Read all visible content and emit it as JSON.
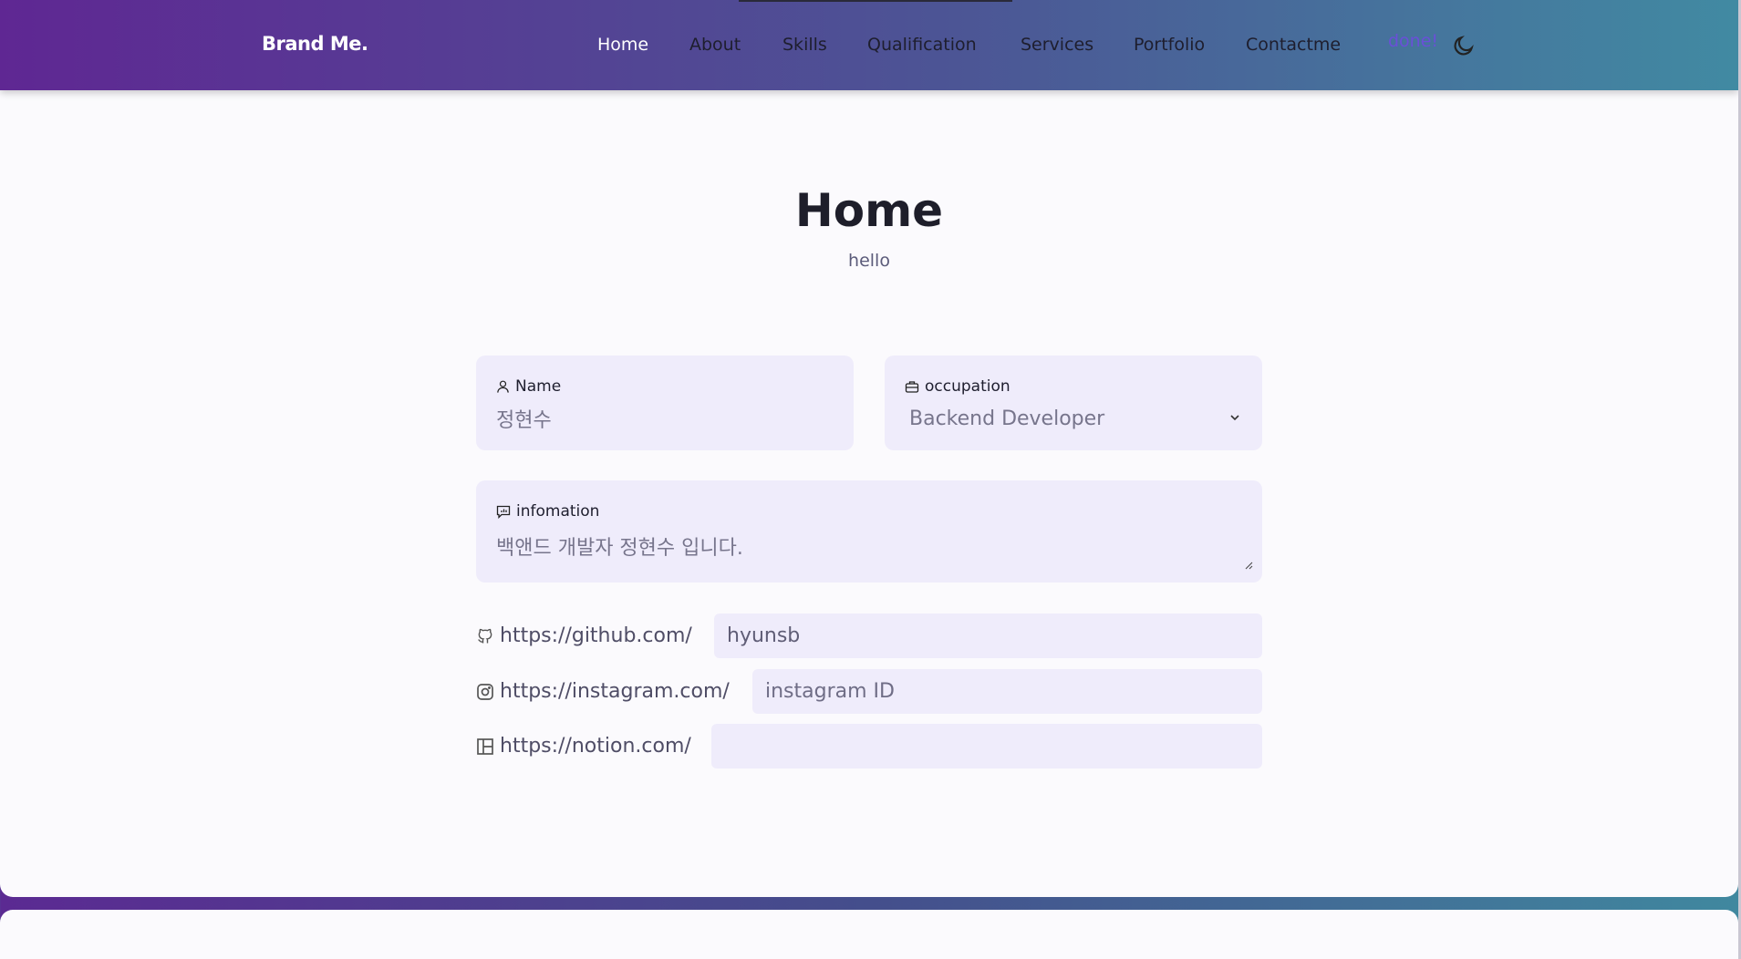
{
  "nav": {
    "brand": "Brand Me.",
    "items": [
      {
        "label": "Home",
        "active": true
      },
      {
        "label": "About"
      },
      {
        "label": "Skills"
      },
      {
        "label": "Qualification"
      },
      {
        "label": "Services"
      },
      {
        "label": "Portfolio"
      },
      {
        "label": "Contactme"
      }
    ],
    "status": "done!",
    "theme_icon": "moon-icon"
  },
  "home": {
    "title": "Home",
    "subtitle": "hello",
    "name": {
      "label": "Name",
      "value": "정현수",
      "icon": "user-icon"
    },
    "occupation": {
      "label": "occupation",
      "value": "Backend Developer",
      "icon": "briefcase-icon"
    },
    "information": {
      "label": "infomation",
      "value": "백앤드 개발자 정현수 입니다.",
      "icon": "message-icon"
    },
    "links": [
      {
        "prefix": "https://github.com/",
        "value": "hyunsb",
        "placeholder": "",
        "icon": "github-icon"
      },
      {
        "prefix": "https://instagram.com/",
        "value": "",
        "placeholder": "instagram ID",
        "icon": "instagram-icon"
      },
      {
        "prefix": "https://notion.com/",
        "value": "",
        "placeholder": "",
        "icon": "notion-icon"
      }
    ]
  },
  "colors": {
    "accent": "#6a4fd8",
    "field_bg": "#efecfb",
    "page_bg": "#fbfafd"
  }
}
